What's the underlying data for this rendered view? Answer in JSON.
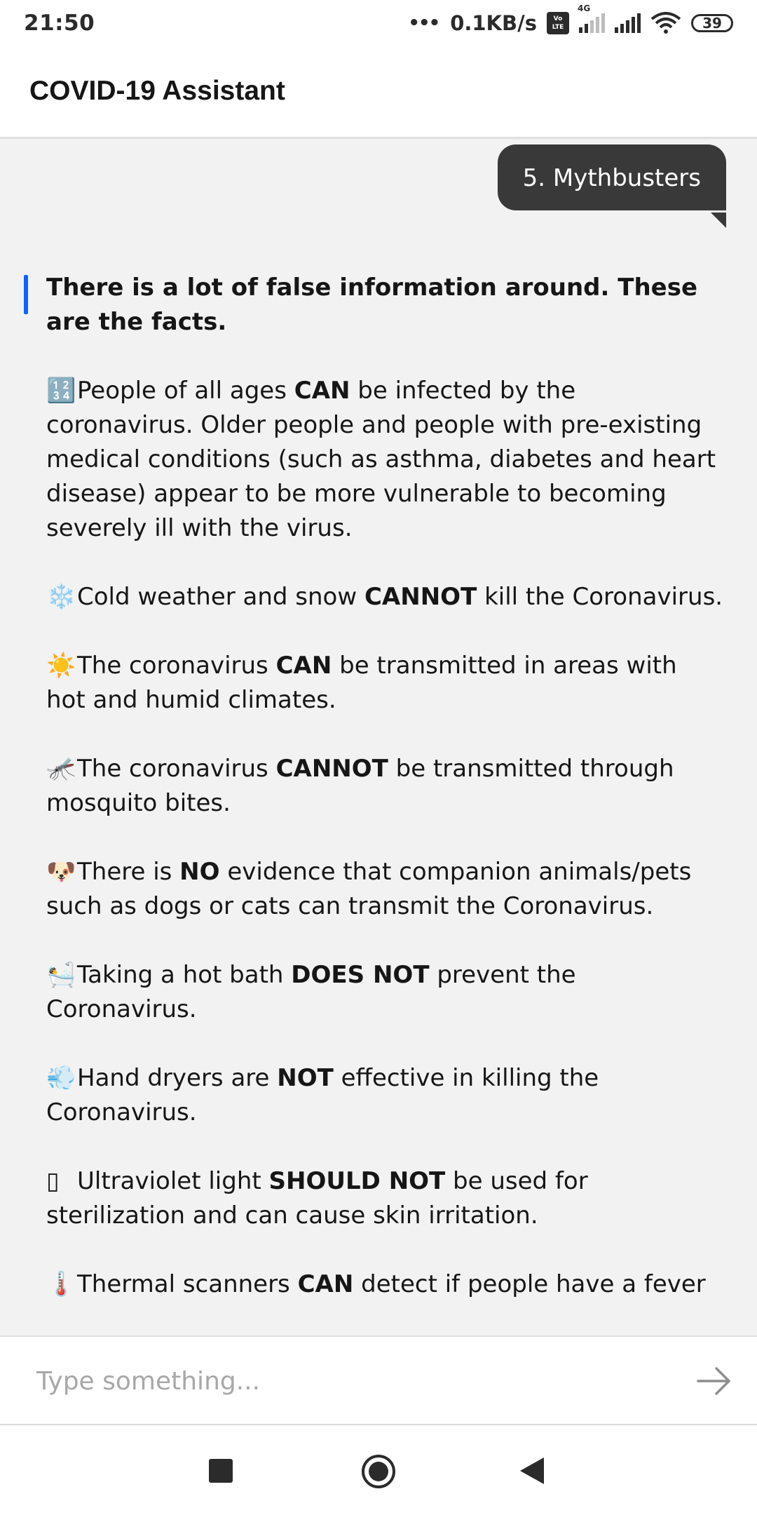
{
  "status_bar": {
    "time": "21:50",
    "dots": "•••",
    "net_speed": "0.1KB/s",
    "volte": [
      "Vo",
      "LTE"
    ],
    "network": "4G",
    "battery": "39"
  },
  "app": {
    "title": "COVID-19 Assistant"
  },
  "chat": {
    "user_message": "5. Mythbusters",
    "bot_headline": "There is a lot of false information around. These are the facts.",
    "facts": [
      {
        "icon": "🔢",
        "icon_name": "numbers-icon",
        "pre": "People of all ages ",
        "bold": "CAN",
        "post": " be infected by the coronavirus. Older people and people with pre-existing medical conditions (such as asthma, diabetes and heart disease) appear to be more vulnerable to becoming severely ill with the virus."
      },
      {
        "icon": "❄️",
        "icon_name": "snowflake-icon",
        "pre": "Cold weather and snow ",
        "bold": "CANNOT",
        "post": " kill the Coronavirus."
      },
      {
        "icon": "☀️",
        "icon_name": "sun-icon",
        "pre": "The coronavirus ",
        "bold": "CAN",
        "post": " be transmitted in areas with hot and humid climates."
      },
      {
        "icon": "🦟",
        "icon_name": "mosquito-icon",
        "pre": "The coronavirus ",
        "bold": "CANNOT",
        "post": " be transmitted through mosquito bites."
      },
      {
        "icon": "🐶",
        "icon_name": "dog-icon",
        "pre": "There is ",
        "bold": "NO",
        "post": " evidence that companion animals/pets such as dogs or cats can transmit the Coronavirus."
      },
      {
        "icon": "🛀",
        "icon_name": "bath-icon",
        "pre": "Taking a hot bath ",
        "bold": "DOES NOT",
        "post": " prevent the Coronavirus."
      },
      {
        "icon": "💨",
        "icon_name": "wind-icon",
        "pre": "Hand dryers are ",
        "bold": "NOT",
        "post": " effective in killing the Coronavirus."
      },
      {
        "icon": "▯",
        "icon_name": "missing-glyph-icon",
        "pre": "Ultraviolet light ",
        "bold": "SHOULD NOT",
        "post": " be used for sterilization and can cause skin irritation."
      },
      {
        "icon": "🌡️",
        "icon_name": "thermometer-icon",
        "pre": "Thermal scanners ",
        "bold": "CAN",
        "post": " detect if people have a fever"
      }
    ]
  },
  "input": {
    "placeholder": "Type something..."
  },
  "colors": {
    "accent": "#0f62fe",
    "user_bubble": "#393939",
    "background": "#f2f2f2"
  }
}
